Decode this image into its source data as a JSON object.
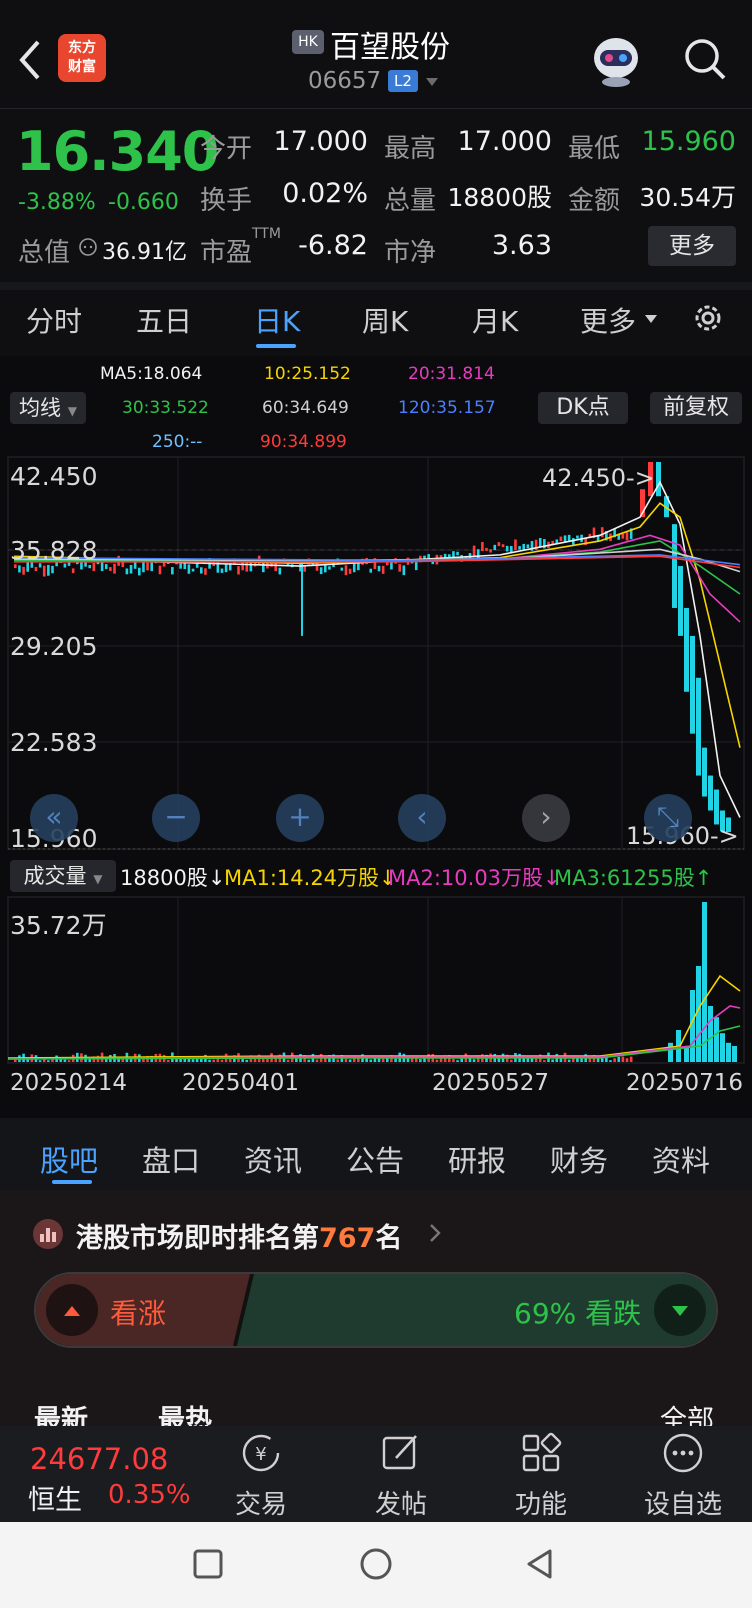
{
  "header": {
    "logo_line1": "东方",
    "logo_line2": "财富",
    "market_badge": "HK",
    "stock_name": "百望股份",
    "stock_code": "06657",
    "level_badge": "L2"
  },
  "quote": {
    "price": "16.340",
    "change_pct": "-3.88%",
    "change_abs": "-0.660",
    "open_label": "今开",
    "open": "17.000",
    "high_label": "最高",
    "high": "17.000",
    "low_label": "最低",
    "low": "15.960",
    "turnover_label": "换手",
    "turnover": "0.02%",
    "volume_label": "总量",
    "volume": "18800股",
    "amount_label": "金额",
    "amount": "30.54万",
    "mktcap_label": "总值",
    "mktcap": "36.91亿",
    "pe_label": "市盈",
    "pe_sup": "TTM",
    "pe": "-6.82",
    "pb_label": "市净",
    "pb": "3.63",
    "more_label": "更多"
  },
  "period_tabs": [
    "分时",
    "五日",
    "日K",
    "周K",
    "月K",
    "更多"
  ],
  "active_period": "日K",
  "ma": {
    "ma5": "MA5:18.064",
    "ma10": "10:25.152",
    "ma20": "20:31.814",
    "ma30": "30:33.522",
    "ma60": "60:34.649",
    "ma120": "120:35.157",
    "ma250": "250:--",
    "ma90": "90:34.899",
    "indicator_label": "均线",
    "dk_label": "DK点",
    "adjust_label": "前复权"
  },
  "price_axis": [
    "42.450",
    "35.828",
    "29.205",
    "22.583",
    "15.960"
  ],
  "max_marker": "42.450->",
  "min_marker": "15.960->",
  "volume_panel": {
    "indicator_label": "成交量",
    "vol": "18800股",
    "ma1": "MA1:14.24万股",
    "ma2": "MA2:10.03万股",
    "ma3": "MA3:61255股",
    "axis_max": "35.72万"
  },
  "dates": [
    "20250214",
    "20250401",
    "20250527",
    "20250716"
  ],
  "info_tabs": [
    "股吧",
    "盘口",
    "资讯",
    "公告",
    "研报",
    "财务",
    "资料"
  ],
  "active_info_tab": "股吧",
  "ranking": {
    "prefix": "港股市场即时排名第",
    "rank": "767",
    "suffix": "名"
  },
  "sentiment": {
    "bull_label": "看涨",
    "bear_label": "69% 看跌",
    "bear_fraction": 0.69
  },
  "feed_sort": {
    "latest": "最新",
    "hottest": "最热",
    "filter": "全部"
  },
  "index": {
    "value": "24677.08",
    "name": "恒生",
    "change": "0.35%"
  },
  "nav": [
    "交易",
    "发帖",
    "功能",
    "设自选"
  ],
  "colors": {
    "up": "#ff3b3b",
    "down": "#2ec24a",
    "accent": "#4aa3ff",
    "candle_down": "#20d4e6"
  }
}
